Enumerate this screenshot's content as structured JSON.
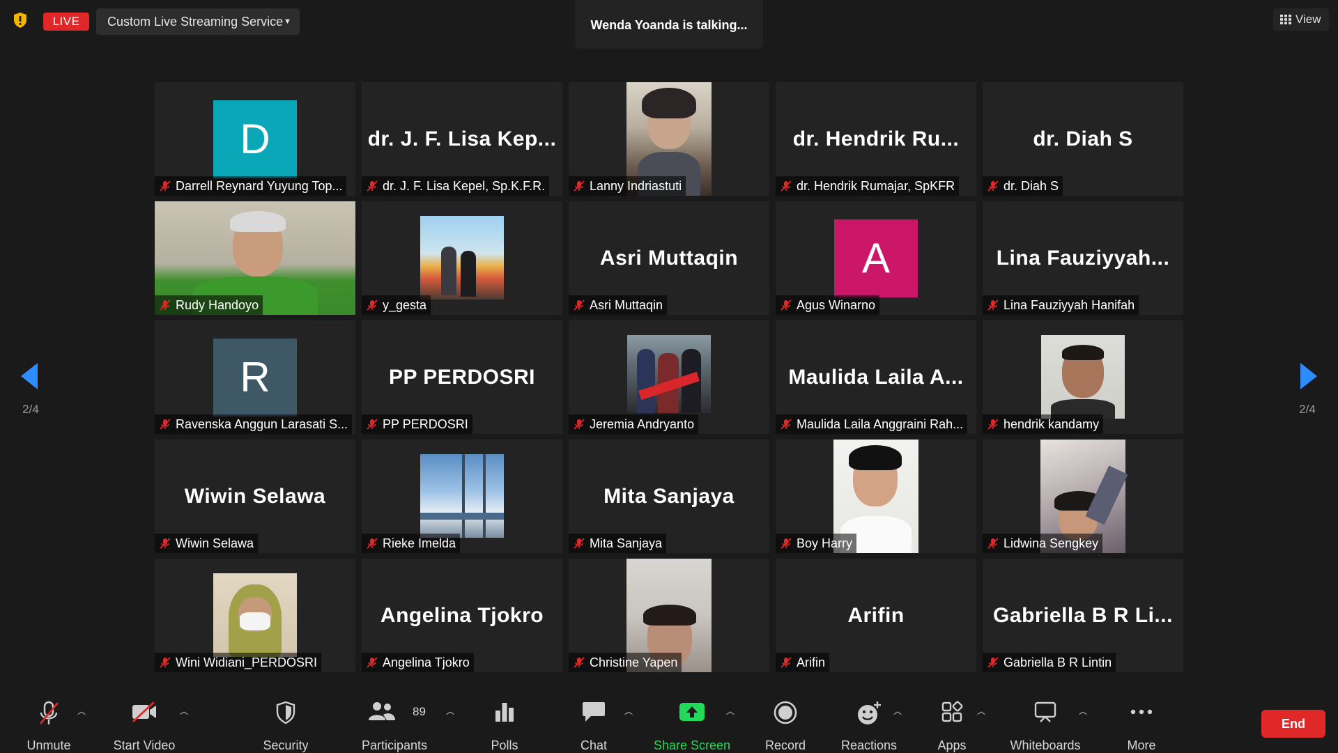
{
  "topbar": {
    "live_label": "LIVE",
    "stream_service": "Custom Live Streaming Service",
    "talking": "Wenda Yoanda is talking...",
    "view_label": "View"
  },
  "pagination": {
    "left": "2/4",
    "right": "2/4"
  },
  "participants": [
    {
      "name": "Darrell Reynard Yuyung Top...",
      "tile": "avatar",
      "letter": "D",
      "color": "#0aa7b8"
    },
    {
      "name": "dr. J. F. Lisa Kepel, Sp.K.F.R.",
      "tile": "text",
      "display": "dr. J. F. Lisa Kep..."
    },
    {
      "name": "Lanny Indriastuti",
      "tile": "video"
    },
    {
      "name": "dr. Hendrik Rumajar, SpKFR",
      "tile": "text",
      "display": "dr. Hendrik Ru..."
    },
    {
      "name": "dr. Diah S",
      "tile": "text",
      "display": "dr. Diah S"
    },
    {
      "name": "Rudy Handoyo",
      "tile": "video"
    },
    {
      "name": "y_gesta",
      "tile": "photo"
    },
    {
      "name": "Asri Muttaqin",
      "tile": "text",
      "display": "Asri Muttaqin"
    },
    {
      "name": "Agus Winarno",
      "tile": "avatar",
      "letter": "A",
      "color": "#cc1768"
    },
    {
      "name": "Lina Fauziyyah Hanifah",
      "tile": "text",
      "display": "Lina  Fauziyyah..."
    },
    {
      "name": "Ravenska Anggun Larasati S...",
      "tile": "avatar",
      "letter": "R",
      "color": "#3f5866"
    },
    {
      "name": "PP PERDOSRI",
      "tile": "text",
      "display": "PP PERDOSRI"
    },
    {
      "name": "Jeremia Andryanto",
      "tile": "photo"
    },
    {
      "name": "Maulida Laila Anggraini Rah...",
      "tile": "text",
      "display": "Maulida Laila A..."
    },
    {
      "name": "hendrik kandamy",
      "tile": "photo"
    },
    {
      "name": "Wiwin Selawa",
      "tile": "text",
      "display": "Wiwin Selawa"
    },
    {
      "name": "Rieke Imelda",
      "tile": "photo"
    },
    {
      "name": "Mita Sanjaya",
      "tile": "text",
      "display": "Mita Sanjaya"
    },
    {
      "name": "Boy Harry",
      "tile": "video"
    },
    {
      "name": "Lidwina Sengkey",
      "tile": "video"
    },
    {
      "name": "Wini Widiani_PERDOSRI",
      "tile": "photo"
    },
    {
      "name": "Angelina Tjokro",
      "tile": "text",
      "display": "Angelina Tjokro"
    },
    {
      "name": "Christine Yapen",
      "tile": "video"
    },
    {
      "name": "Arifin",
      "tile": "text",
      "display": "Arifin"
    },
    {
      "name": "Gabriella B R Lintin",
      "tile": "text",
      "display": "Gabriella B R Li..."
    }
  ],
  "toolbar": {
    "unmute": "Unmute",
    "start_video": "Start Video",
    "security": "Security",
    "participants": "Participants",
    "participants_count": "89",
    "polls": "Polls",
    "chat": "Chat",
    "share_screen": "Share Screen",
    "record": "Record",
    "reactions": "Reactions",
    "apps": "Apps",
    "whiteboards": "Whiteboards",
    "more": "More",
    "end": "End"
  },
  "colors": {
    "live_red": "#e02828",
    "share_green": "#23d959",
    "muted_red": "#e02828",
    "nav_blue": "#2d8cff"
  }
}
